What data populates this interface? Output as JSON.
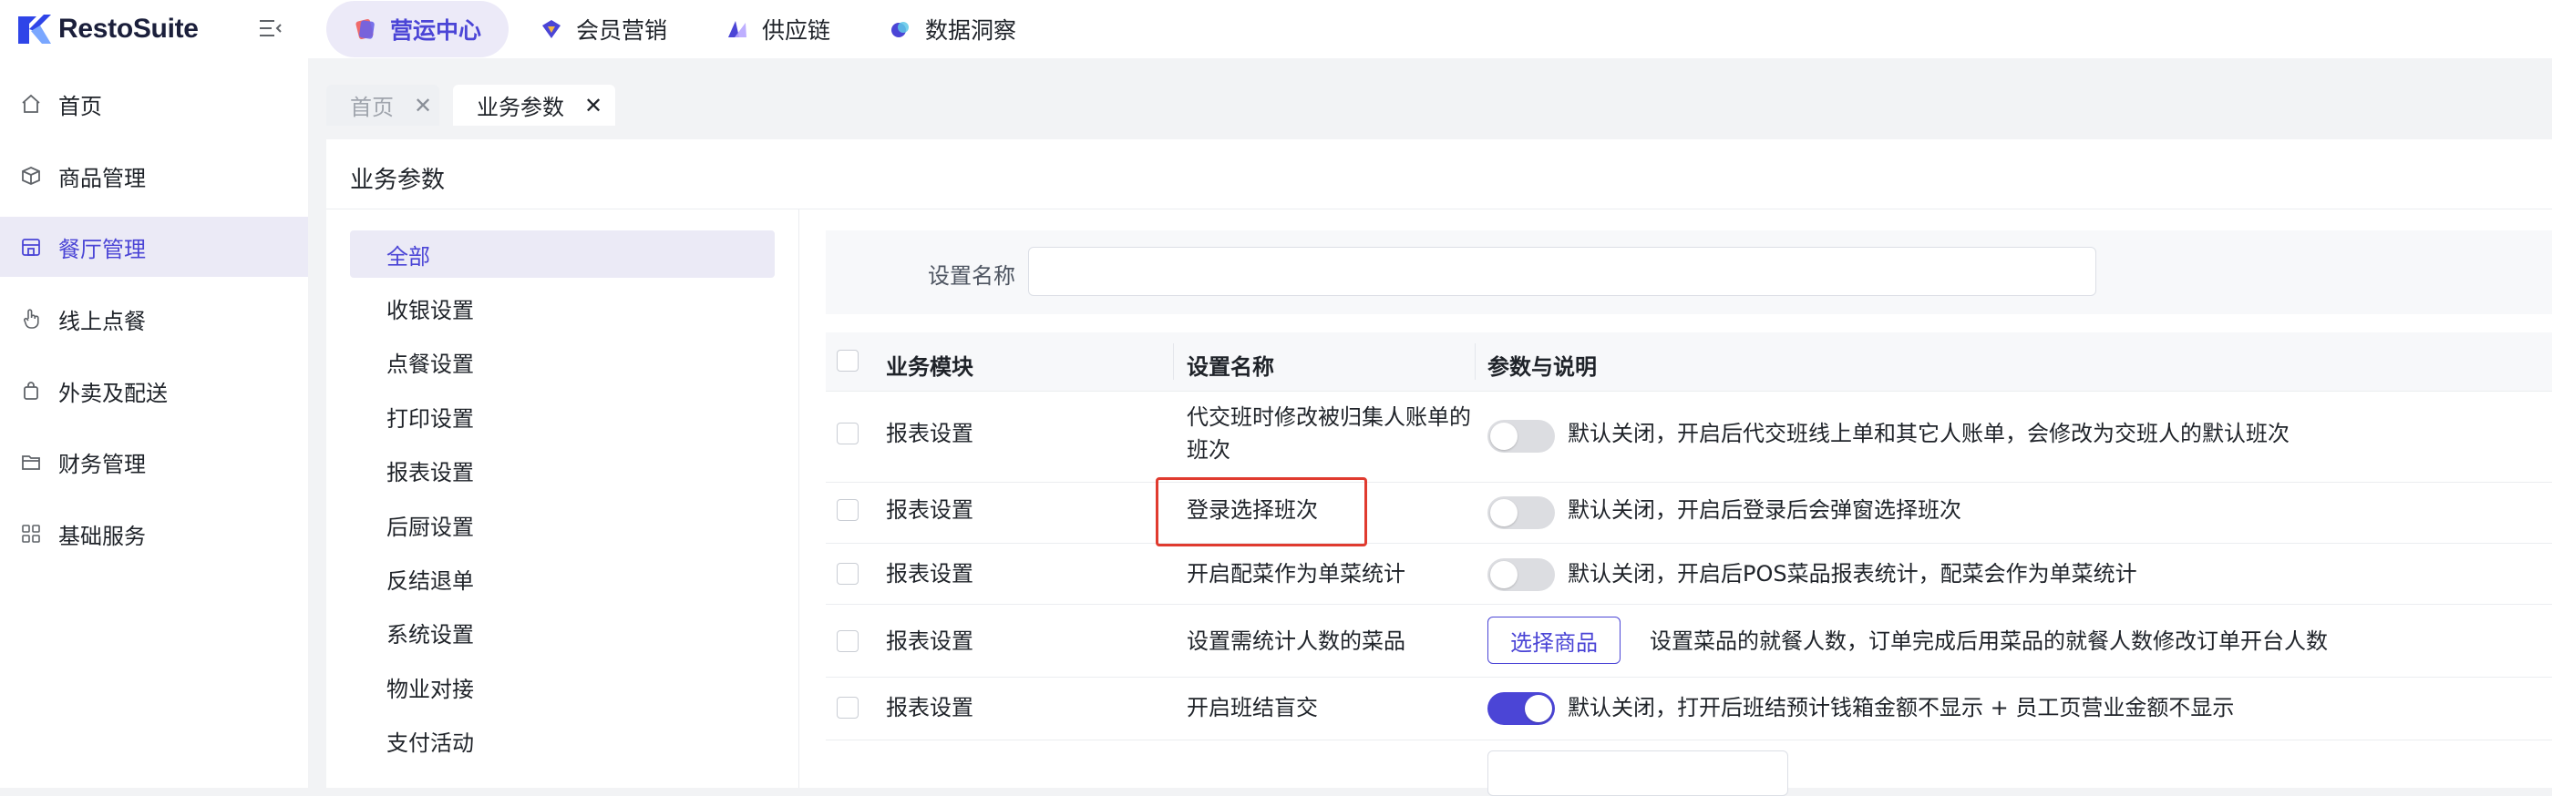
{
  "app": {
    "name": "RestoSuite"
  },
  "topnav": {
    "items": [
      {
        "label": "营运中心",
        "icon": "operations-icon",
        "active": true
      },
      {
        "label": "会员营销",
        "icon": "member-marketing-icon",
        "active": false
      },
      {
        "label": "供应链",
        "icon": "supply-chain-icon",
        "active": false
      },
      {
        "label": "数据洞察",
        "icon": "data-insight-icon",
        "active": false
      }
    ]
  },
  "sidebar": {
    "items": [
      {
        "label": "首页",
        "icon": "home-icon"
      },
      {
        "label": "商品管理",
        "icon": "box-icon"
      },
      {
        "label": "餐厅管理",
        "icon": "store-icon",
        "active": true
      },
      {
        "label": "线上点餐",
        "icon": "hand-pointer-icon"
      },
      {
        "label": "外卖及配送",
        "icon": "bag-icon"
      },
      {
        "label": "财务管理",
        "icon": "folder-icon"
      },
      {
        "label": "基础服务",
        "icon": "grid-icon"
      }
    ]
  },
  "tabs": [
    {
      "label": "首页",
      "active": false
    },
    {
      "label": "业务参数",
      "active": true
    }
  ],
  "panel": {
    "title": "业务参数"
  },
  "categories": [
    "全部",
    "收银设置",
    "点餐设置",
    "打印设置",
    "报表设置",
    "后厨设置",
    "反结退单",
    "系统设置",
    "物业对接",
    "支付活动"
  ],
  "filter": {
    "label": "设置名称",
    "value": "",
    "placeholder": ""
  },
  "table": {
    "headers": {
      "module": "业务模块",
      "name": "设置名称",
      "param": "参数与说明"
    },
    "rows": [
      {
        "module": "报表设置",
        "name_line1": "代交班时修改被归集人账单的",
        "name_line2": "班次",
        "toggle": false,
        "desc": "默认关闭，开启后代交班线上单和其它人账单，会修改为交班人的默认班次"
      },
      {
        "module": "报表设置",
        "name": "登录选择班次",
        "toggle": false,
        "desc": "默认关闭，开启后登录后会弹窗选择班次"
      },
      {
        "module": "报表设置",
        "name": "开启配菜作为单菜统计",
        "toggle": false,
        "desc": "默认关闭，开启后POS菜品报表统计，配菜会作为单菜统计"
      },
      {
        "module": "报表设置",
        "name": "设置需统计人数的菜品",
        "button": "选择商品",
        "desc": "设置菜品的就餐人数，订单完成后用菜品的就餐人数修改订单开台人数"
      },
      {
        "module": "报表设置",
        "name": "开启班结盲交",
        "toggle": true,
        "desc": "默认关闭，打开后班结预计钱箱金额不显示 + 员工页营业金额不显示"
      }
    ]
  },
  "colors": {
    "accent": "#4b45d6",
    "highlight": "#e03b2f"
  }
}
